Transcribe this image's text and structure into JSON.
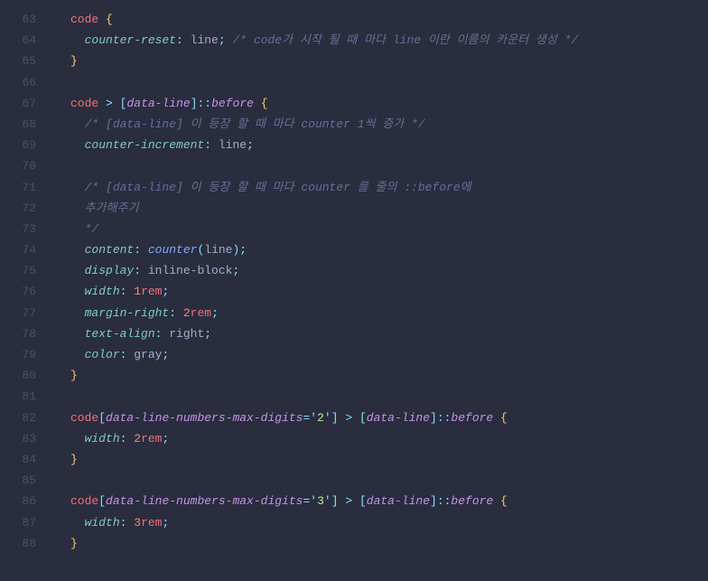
{
  "startLine": 63,
  "lines": [
    {
      "n": 63,
      "t": [
        [
          "tag",
          "code"
        ],
        [
          "sp",
          " "
        ],
        [
          "brace",
          "{"
        ]
      ]
    },
    {
      "n": 64,
      "t": [
        [
          "ind",
          "  "
        ],
        [
          "prop",
          "counter-reset"
        ],
        [
          "punct",
          ":"
        ],
        [
          "sp",
          " "
        ],
        [
          "value",
          "line"
        ],
        [
          "punct",
          ";"
        ],
        [
          "sp",
          " "
        ],
        [
          "comment",
          "/* code가 시작 될 때 마다 line 이란 이름의 카운터 생성 */"
        ]
      ]
    },
    {
      "n": 65,
      "t": [
        [
          "brace",
          "}"
        ]
      ]
    },
    {
      "n": 66,
      "t": []
    },
    {
      "n": 67,
      "t": [
        [
          "tag",
          "code"
        ],
        [
          "sp",
          " "
        ],
        [
          "op",
          ">"
        ],
        [
          "sp",
          " "
        ],
        [
          "punct",
          "["
        ],
        [
          "attr",
          "data-line"
        ],
        [
          "punct",
          "]"
        ],
        [
          "punct",
          "::"
        ],
        [
          "pseudo",
          "before"
        ],
        [
          "sp",
          " "
        ],
        [
          "brace",
          "{"
        ]
      ]
    },
    {
      "n": 68,
      "t": [
        [
          "ind",
          "  "
        ],
        [
          "comment",
          "/* [data-line] 이 등장 할 때 마다 counter 1씩 증가 */"
        ]
      ]
    },
    {
      "n": 69,
      "t": [
        [
          "ind",
          "  "
        ],
        [
          "prop",
          "counter-increment"
        ],
        [
          "punct",
          ":"
        ],
        [
          "sp",
          " "
        ],
        [
          "value",
          "line"
        ],
        [
          "punct",
          ";"
        ]
      ]
    },
    {
      "n": 70,
      "t": []
    },
    {
      "n": 71,
      "t": [
        [
          "ind",
          "  "
        ],
        [
          "comment",
          "/* [data-line] 이 등장 할 때 마다 counter 를 줄의 ::before에"
        ]
      ]
    },
    {
      "n": 72,
      "t": [
        [
          "ind",
          "  "
        ],
        [
          "comment",
          "추가해주기"
        ]
      ]
    },
    {
      "n": 73,
      "t": [
        [
          "ind",
          "  "
        ],
        [
          "comment",
          "*/"
        ]
      ]
    },
    {
      "n": 74,
      "t": [
        [
          "ind",
          "  "
        ],
        [
          "prop",
          "content"
        ],
        [
          "punct",
          ":"
        ],
        [
          "sp",
          " "
        ],
        [
          "func",
          "counter"
        ],
        [
          "punct",
          "("
        ],
        [
          "value",
          "line"
        ],
        [
          "punct",
          ")"
        ],
        [
          "punct",
          ";"
        ]
      ]
    },
    {
      "n": 75,
      "t": [
        [
          "ind",
          "  "
        ],
        [
          "prop",
          "display"
        ],
        [
          "punct",
          ":"
        ],
        [
          "sp",
          " "
        ],
        [
          "value",
          "inline-block"
        ],
        [
          "punct",
          ";"
        ]
      ]
    },
    {
      "n": 76,
      "t": [
        [
          "ind",
          "  "
        ],
        [
          "prop",
          "width"
        ],
        [
          "punct",
          ":"
        ],
        [
          "sp",
          " "
        ],
        [
          "num",
          "1"
        ],
        [
          "unit",
          "rem"
        ],
        [
          "punct",
          ";"
        ]
      ]
    },
    {
      "n": 77,
      "t": [
        [
          "ind",
          "  "
        ],
        [
          "prop",
          "margin-right"
        ],
        [
          "punct",
          ":"
        ],
        [
          "sp",
          " "
        ],
        [
          "num",
          "2"
        ],
        [
          "unit",
          "rem"
        ],
        [
          "punct",
          ";"
        ]
      ]
    },
    {
      "n": 78,
      "t": [
        [
          "ind",
          "  "
        ],
        [
          "prop",
          "text-align"
        ],
        [
          "punct",
          ":"
        ],
        [
          "sp",
          " "
        ],
        [
          "value",
          "right"
        ],
        [
          "punct",
          ";"
        ]
      ]
    },
    {
      "n": 79,
      "t": [
        [
          "ind",
          "  "
        ],
        [
          "prop",
          "color"
        ],
        [
          "punct",
          ":"
        ],
        [
          "sp",
          " "
        ],
        [
          "value",
          "gray"
        ],
        [
          "punct",
          ";"
        ]
      ]
    },
    {
      "n": 80,
      "t": [
        [
          "brace",
          "}"
        ]
      ]
    },
    {
      "n": 81,
      "t": []
    },
    {
      "n": 82,
      "t": [
        [
          "tag",
          "code"
        ],
        [
          "punct",
          "["
        ],
        [
          "attr",
          "data-line-numbers-max-digits"
        ],
        [
          "punct",
          "="
        ],
        [
          "punct",
          "'"
        ],
        [
          "attrv",
          "2"
        ],
        [
          "punct",
          "'"
        ],
        [
          "punct",
          "]"
        ],
        [
          "sp",
          " "
        ],
        [
          "op",
          ">"
        ],
        [
          "sp",
          " "
        ],
        [
          "punct",
          "["
        ],
        [
          "attr",
          "data-line"
        ],
        [
          "punct",
          "]"
        ],
        [
          "punct",
          "::"
        ],
        [
          "pseudo",
          "before"
        ],
        [
          "sp",
          " "
        ],
        [
          "brace",
          "{"
        ]
      ]
    },
    {
      "n": 83,
      "t": [
        [
          "ind",
          "  "
        ],
        [
          "prop",
          "width"
        ],
        [
          "punct",
          ":"
        ],
        [
          "sp",
          " "
        ],
        [
          "num",
          "2"
        ],
        [
          "unit",
          "rem"
        ],
        [
          "punct",
          ";"
        ]
      ]
    },
    {
      "n": 84,
      "t": [
        [
          "brace",
          "}"
        ]
      ]
    },
    {
      "n": 85,
      "t": []
    },
    {
      "n": 86,
      "t": [
        [
          "tag",
          "code"
        ],
        [
          "punct",
          "["
        ],
        [
          "attr",
          "data-line-numbers-max-digits"
        ],
        [
          "punct",
          "="
        ],
        [
          "punct",
          "'"
        ],
        [
          "attrv",
          "3"
        ],
        [
          "punct",
          "'"
        ],
        [
          "punct",
          "]"
        ],
        [
          "sp",
          " "
        ],
        [
          "op",
          ">"
        ],
        [
          "sp",
          " "
        ],
        [
          "punct",
          "["
        ],
        [
          "attr",
          "data-line"
        ],
        [
          "punct",
          "]"
        ],
        [
          "punct",
          "::"
        ],
        [
          "pseudo",
          "before"
        ],
        [
          "sp",
          " "
        ],
        [
          "brace",
          "{"
        ]
      ]
    },
    {
      "n": 87,
      "t": [
        [
          "ind",
          "  "
        ],
        [
          "prop",
          "width"
        ],
        [
          "punct",
          ":"
        ],
        [
          "sp",
          " "
        ],
        [
          "num",
          "3"
        ],
        [
          "unit",
          "rem"
        ],
        [
          "punct",
          ";"
        ]
      ]
    },
    {
      "n": 88,
      "t": [
        [
          "brace",
          "}"
        ]
      ]
    }
  ]
}
